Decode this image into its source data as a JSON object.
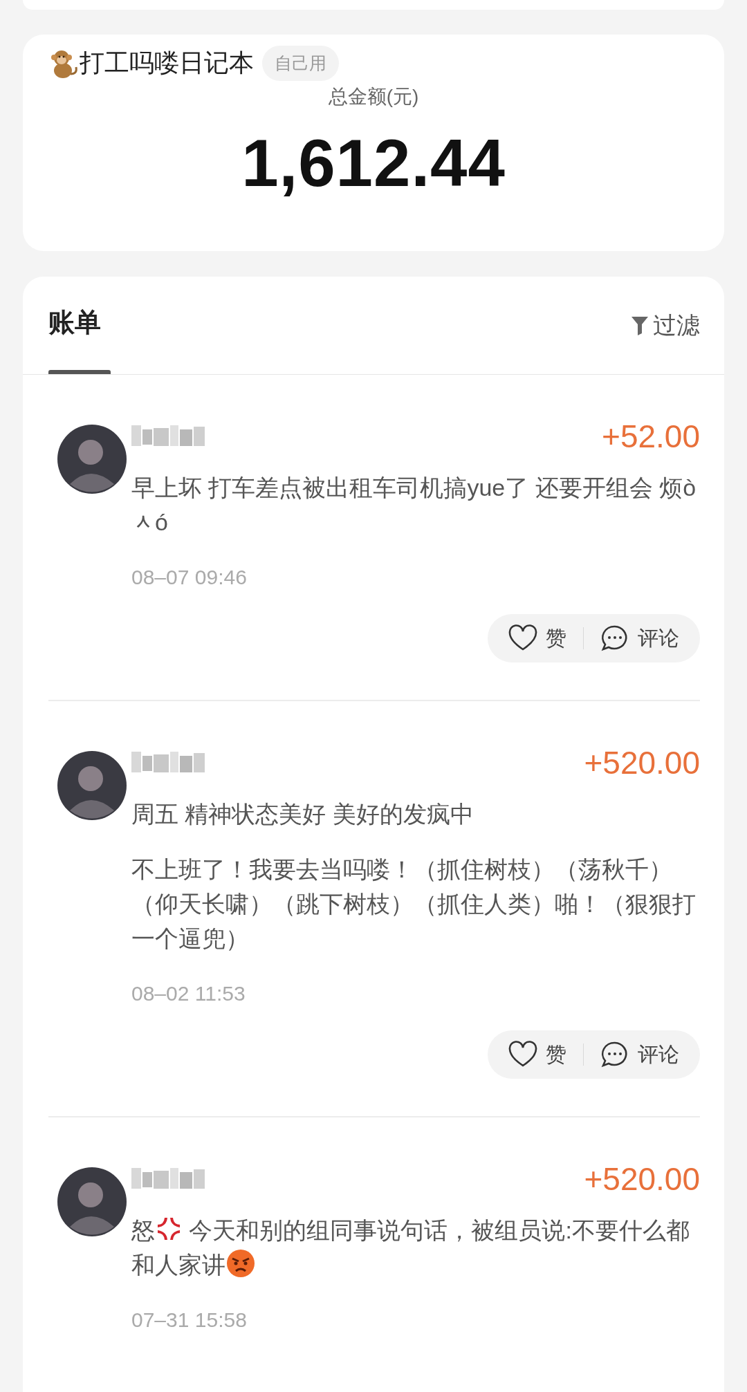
{
  "notebook": {
    "title": "打工吗喽日记本",
    "badge": "自己用",
    "total_label": "总金额(元)",
    "total": "1,612.44"
  },
  "bills": {
    "tab": "账单",
    "filter": "过滤",
    "entries": [
      {
        "amount": "+52.00",
        "paragraphs": [
          [
            {
              "kind": "text",
              "text": "早上坏 打车差点被出租车司机搞yue了 还要开组会 烦òᆺó"
            }
          ]
        ],
        "date": "08–07 09:46",
        "like": "赞",
        "comment": "评论"
      },
      {
        "amount": "+520.00",
        "paragraphs": [
          [
            {
              "kind": "text",
              "text": "周五 精神状态美好 美好的发疯中"
            }
          ],
          [
            {
              "kind": "text",
              "text": "不上班了！我要去当吗喽！（抓住树枝）（荡秋千）（仰天长啸）（跳下树枝）（抓住人类）啪！（狠狠打一个逼兜）"
            }
          ]
        ],
        "date": "08–02 11:53",
        "like": "赞",
        "comment": "评论"
      },
      {
        "amount": "+520.00",
        "paragraphs": [
          [
            {
              "kind": "text",
              "text": "怒"
            },
            {
              "kind": "anger_mark"
            },
            {
              "kind": "text",
              "text": " 今天和别的组同事说句话，被组员说:不要什么都和人家讲"
            },
            {
              "kind": "angry_face"
            }
          ]
        ],
        "date": "07–31 15:58"
      }
    ]
  }
}
